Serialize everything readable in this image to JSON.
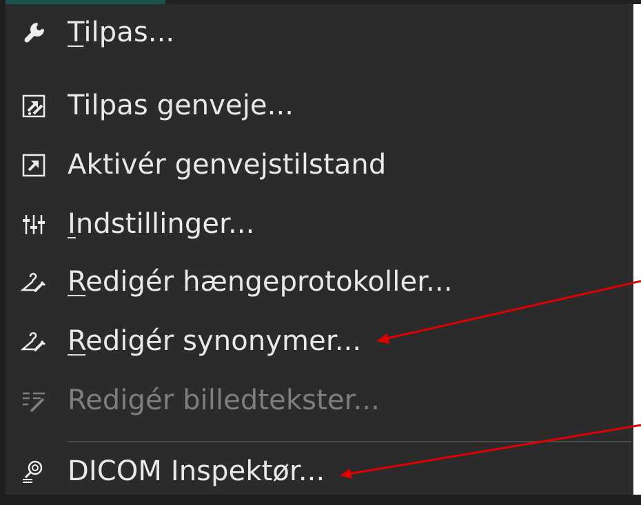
{
  "menu": {
    "items": [
      {
        "mnemonic": "T",
        "rest": "ilpas...",
        "icon": "wrench-icon",
        "enabled": true
      },
      {
        "label": "Tilpas genveje...",
        "icon": "shortcut-edit-icon",
        "enabled": true
      },
      {
        "label": "Aktivér genvejstilstand",
        "icon": "shortcut-arrow-icon",
        "enabled": true
      },
      {
        "mnemonic": "I",
        "rest": "ndstillinger...",
        "icon": "sliders-icon",
        "enabled": true
      },
      {
        "mnemonic": "R",
        "rest": "edigér hængeprotokoller...",
        "icon": "hanger-edit-icon",
        "enabled": true
      },
      {
        "mnemonic": "R",
        "rest": "edigér synonymer...",
        "icon": "hanger-edit-icon",
        "enabled": true
      },
      {
        "label": "Redigér billedtekster...",
        "icon": "text-edit-icon",
        "enabled": false
      },
      {
        "label": "DICOM Inspektør...",
        "icon": "dicom-inspect-icon",
        "enabled": true
      }
    ]
  },
  "colors": {
    "menu_bg": "#2b2b2b",
    "text": "#e9e9e9",
    "disabled_text": "#7e7e7e",
    "annotation_arrow": "#e00000"
  }
}
